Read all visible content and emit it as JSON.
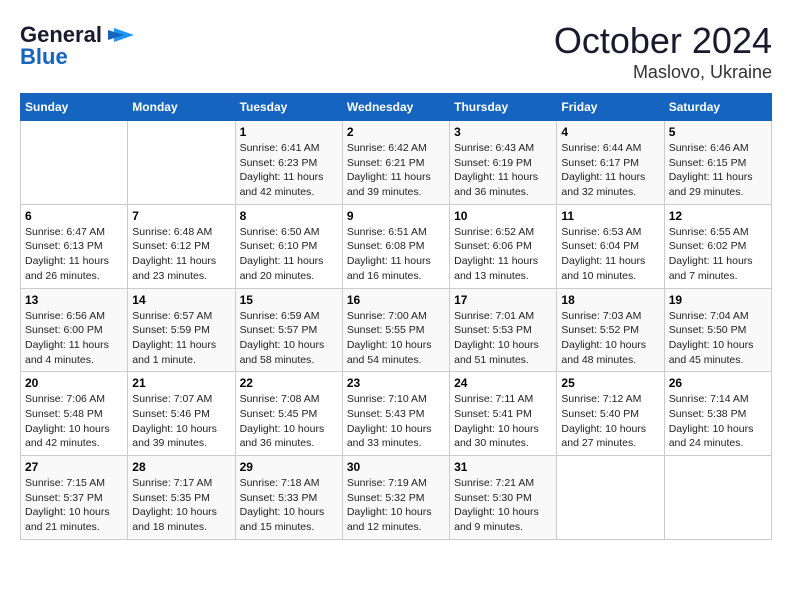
{
  "logo": {
    "general": "General",
    "blue": "Blue",
    "bird_icon": "▶"
  },
  "title": "October 2024",
  "subtitle": "Maslovo, Ukraine",
  "days_of_week": [
    "Sunday",
    "Monday",
    "Tuesday",
    "Wednesday",
    "Thursday",
    "Friday",
    "Saturday"
  ],
  "weeks": [
    [
      {
        "day": "",
        "detail": ""
      },
      {
        "day": "",
        "detail": ""
      },
      {
        "day": "1",
        "detail": "Sunrise: 6:41 AM\nSunset: 6:23 PM\nDaylight: 11 hours and 42 minutes."
      },
      {
        "day": "2",
        "detail": "Sunrise: 6:42 AM\nSunset: 6:21 PM\nDaylight: 11 hours and 39 minutes."
      },
      {
        "day": "3",
        "detail": "Sunrise: 6:43 AM\nSunset: 6:19 PM\nDaylight: 11 hours and 36 minutes."
      },
      {
        "day": "4",
        "detail": "Sunrise: 6:44 AM\nSunset: 6:17 PM\nDaylight: 11 hours and 32 minutes."
      },
      {
        "day": "5",
        "detail": "Sunrise: 6:46 AM\nSunset: 6:15 PM\nDaylight: 11 hours and 29 minutes."
      }
    ],
    [
      {
        "day": "6",
        "detail": "Sunrise: 6:47 AM\nSunset: 6:13 PM\nDaylight: 11 hours and 26 minutes."
      },
      {
        "day": "7",
        "detail": "Sunrise: 6:48 AM\nSunset: 6:12 PM\nDaylight: 11 hours and 23 minutes."
      },
      {
        "day": "8",
        "detail": "Sunrise: 6:50 AM\nSunset: 6:10 PM\nDaylight: 11 hours and 20 minutes."
      },
      {
        "day": "9",
        "detail": "Sunrise: 6:51 AM\nSunset: 6:08 PM\nDaylight: 11 hours and 16 minutes."
      },
      {
        "day": "10",
        "detail": "Sunrise: 6:52 AM\nSunset: 6:06 PM\nDaylight: 11 hours and 13 minutes."
      },
      {
        "day": "11",
        "detail": "Sunrise: 6:53 AM\nSunset: 6:04 PM\nDaylight: 11 hours and 10 minutes."
      },
      {
        "day": "12",
        "detail": "Sunrise: 6:55 AM\nSunset: 6:02 PM\nDaylight: 11 hours and 7 minutes."
      }
    ],
    [
      {
        "day": "13",
        "detail": "Sunrise: 6:56 AM\nSunset: 6:00 PM\nDaylight: 11 hours and 4 minutes."
      },
      {
        "day": "14",
        "detail": "Sunrise: 6:57 AM\nSunset: 5:59 PM\nDaylight: 11 hours and 1 minute."
      },
      {
        "day": "15",
        "detail": "Sunrise: 6:59 AM\nSunset: 5:57 PM\nDaylight: 10 hours and 58 minutes."
      },
      {
        "day": "16",
        "detail": "Sunrise: 7:00 AM\nSunset: 5:55 PM\nDaylight: 10 hours and 54 minutes."
      },
      {
        "day": "17",
        "detail": "Sunrise: 7:01 AM\nSunset: 5:53 PM\nDaylight: 10 hours and 51 minutes."
      },
      {
        "day": "18",
        "detail": "Sunrise: 7:03 AM\nSunset: 5:52 PM\nDaylight: 10 hours and 48 minutes."
      },
      {
        "day": "19",
        "detail": "Sunrise: 7:04 AM\nSunset: 5:50 PM\nDaylight: 10 hours and 45 minutes."
      }
    ],
    [
      {
        "day": "20",
        "detail": "Sunrise: 7:06 AM\nSunset: 5:48 PM\nDaylight: 10 hours and 42 minutes."
      },
      {
        "day": "21",
        "detail": "Sunrise: 7:07 AM\nSunset: 5:46 PM\nDaylight: 10 hours and 39 minutes."
      },
      {
        "day": "22",
        "detail": "Sunrise: 7:08 AM\nSunset: 5:45 PM\nDaylight: 10 hours and 36 minutes."
      },
      {
        "day": "23",
        "detail": "Sunrise: 7:10 AM\nSunset: 5:43 PM\nDaylight: 10 hours and 33 minutes."
      },
      {
        "day": "24",
        "detail": "Sunrise: 7:11 AM\nSunset: 5:41 PM\nDaylight: 10 hours and 30 minutes."
      },
      {
        "day": "25",
        "detail": "Sunrise: 7:12 AM\nSunset: 5:40 PM\nDaylight: 10 hours and 27 minutes."
      },
      {
        "day": "26",
        "detail": "Sunrise: 7:14 AM\nSunset: 5:38 PM\nDaylight: 10 hours and 24 minutes."
      }
    ],
    [
      {
        "day": "27",
        "detail": "Sunrise: 7:15 AM\nSunset: 5:37 PM\nDaylight: 10 hours and 21 minutes."
      },
      {
        "day": "28",
        "detail": "Sunrise: 7:17 AM\nSunset: 5:35 PM\nDaylight: 10 hours and 18 minutes."
      },
      {
        "day": "29",
        "detail": "Sunrise: 7:18 AM\nSunset: 5:33 PM\nDaylight: 10 hours and 15 minutes."
      },
      {
        "day": "30",
        "detail": "Sunrise: 7:19 AM\nSunset: 5:32 PM\nDaylight: 10 hours and 12 minutes."
      },
      {
        "day": "31",
        "detail": "Sunrise: 7:21 AM\nSunset: 5:30 PM\nDaylight: 10 hours and 9 minutes."
      },
      {
        "day": "",
        "detail": ""
      },
      {
        "day": "",
        "detail": ""
      }
    ]
  ]
}
